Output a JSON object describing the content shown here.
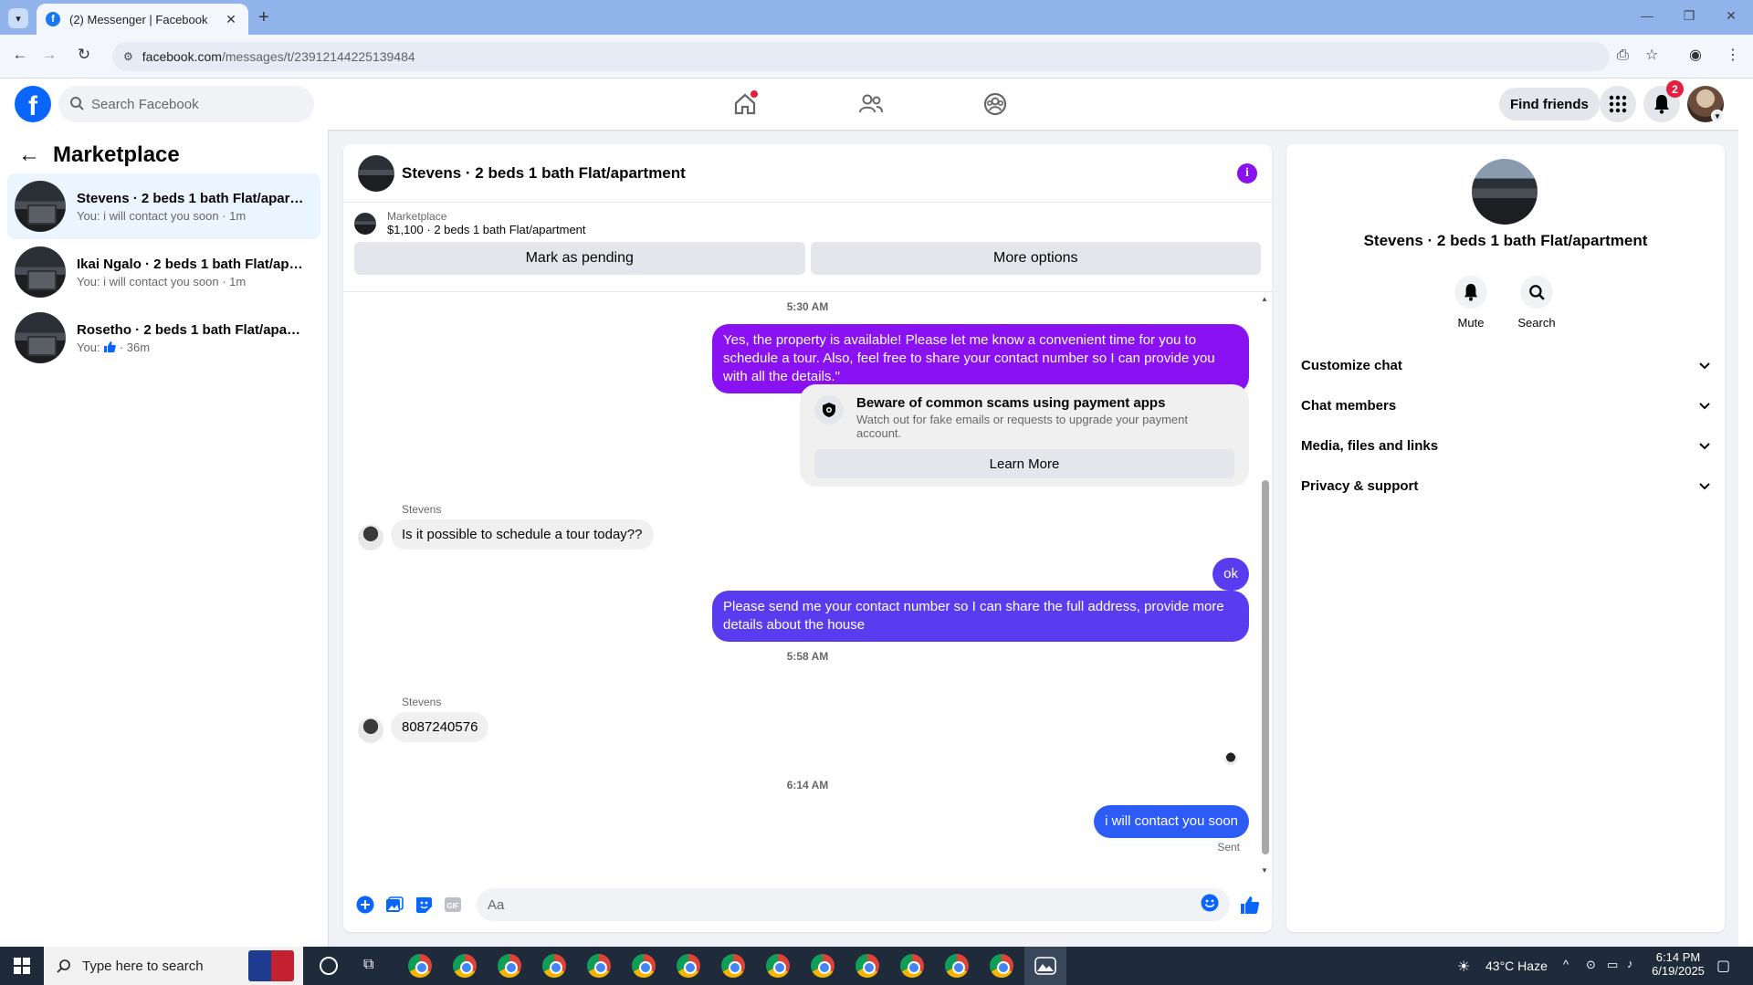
{
  "browser": {
    "tab_title": "(2) Messenger | Facebook",
    "url_host": "facebook.com",
    "url_path": "/messages/t/23912144225139484"
  },
  "header": {
    "search_placeholder": "Search Facebook",
    "find_friends": "Find friends",
    "notification_count": "2"
  },
  "sidebar": {
    "title": "Marketplace",
    "conversations": [
      {
        "name": "Stevens · 2 beds 1 bath Flat/apart...",
        "preview": "You: i will contact you soon · 1m"
      },
      {
        "name": "Ikai Ngalo · 2 beds 1 bath Flat/apa...",
        "preview": "You: i will contact you soon · 1m"
      },
      {
        "name": "Rosetho · 2 beds 1 bath Flat/apart...",
        "preview_prefix": "You:",
        "preview_suffix": "· 36m"
      }
    ]
  },
  "chat": {
    "title": "Stevens · 2 beds 1 bath Flat/apartment",
    "listing_label": "Marketplace",
    "listing_detail": "$1,100 · 2 beds 1 bath Flat/apartment",
    "mark_pending": "Mark as pending",
    "more_options": "More options",
    "messages": {
      "ts1": "5:30 AM",
      "out1": "Yes, the property is available! Please let me know a convenient time for you to schedule a tour. Also, feel free to share your contact number so I can provide you with all the details.\"",
      "scam_title": "Beware of common scams using payment apps",
      "scam_text": "Watch out for fake emails or requests to upgrade your payment account.",
      "learn_more": "Learn More",
      "sender1": "Stevens",
      "in1": "Is it possible to schedule a tour today??",
      "out2": "ok",
      "out3": "Please send me your contact number so I can share the full address, provide more details about the house",
      "ts2": "5:58 AM",
      "sender2": "Stevens",
      "in2": "8087240576",
      "ts3": "6:14 AM",
      "out4": "i will contact you soon",
      "sent": "Sent"
    },
    "composer_placeholder": "Aa"
  },
  "details": {
    "name": "Stevens · 2 beds 1 bath Flat/apartment",
    "mute": "Mute",
    "search": "Search",
    "sections": [
      "Customize chat",
      "Chat members",
      "Media, files and links",
      "Privacy & support"
    ]
  },
  "taskbar": {
    "search_placeholder": "Type here to search",
    "weather": "43°C  Haze",
    "time": "6:14 PM",
    "date": "6/19/2025"
  },
  "colors": {
    "fb_blue": "#0866ff",
    "purple_bubble": "#8a12f2",
    "blue_bubble": "#2c5cf5",
    "notif_red": "#e41e3f"
  }
}
